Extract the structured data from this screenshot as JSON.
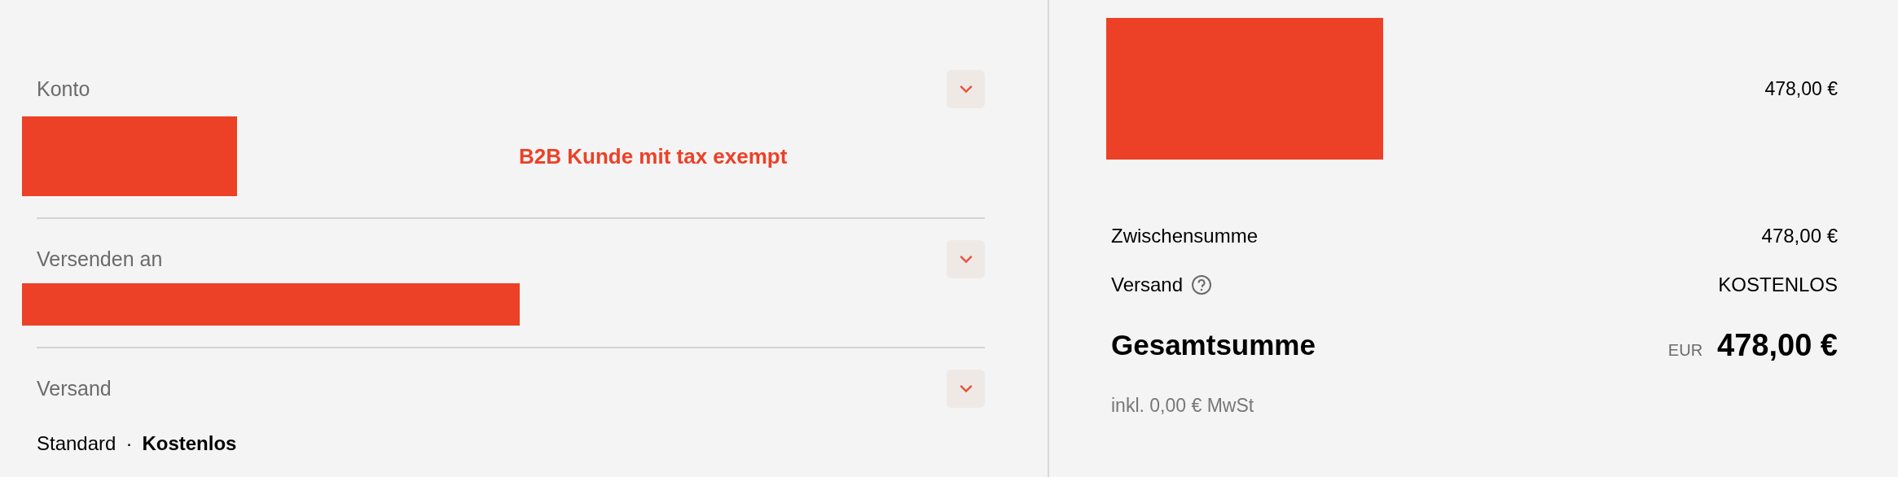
{
  "sections": [
    {
      "kind": "account",
      "label": "Konto",
      "note": "B2B Kunde mit tax exempt"
    },
    {
      "kind": "address",
      "label": "Versenden an"
    },
    {
      "kind": "shipping",
      "label": "Versand",
      "method": "Standard",
      "separator": "·",
      "price": "Kostenlos"
    }
  ],
  "summary": {
    "item_price": "478,00 €",
    "rows": [
      {
        "label": "Zwischensumme",
        "value": "478,00 €",
        "help": false
      },
      {
        "label": "Versand",
        "value": "KOSTENLOS",
        "help": true
      }
    ],
    "total": {
      "label": "Gesamtsumme",
      "currency": "EUR",
      "value": "478,00 €"
    },
    "tax_note": "inkl. 0,00 € MwSt"
  }
}
